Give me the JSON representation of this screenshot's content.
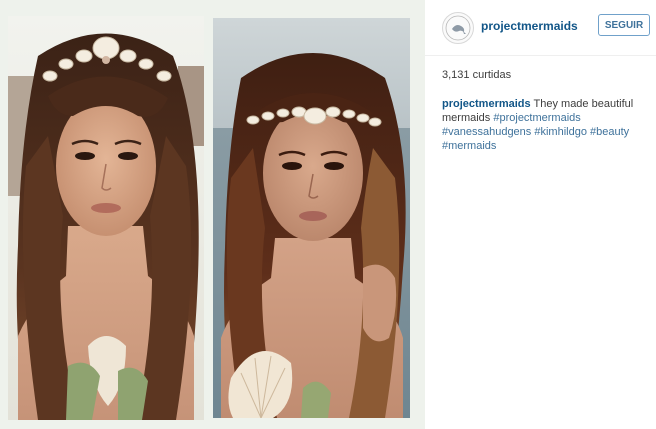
{
  "post": {
    "username": "projectmermaids",
    "follow_label": "SEGUIR",
    "likes": "3,131 curtidas",
    "caption": {
      "username": "projectmermaids",
      "text": "They made beautiful mermaids",
      "hashtags": [
        "#projectmermaids",
        "#vanessahudgens",
        "#kimhildgo",
        "#beauty",
        "#mermaids"
      ]
    }
  },
  "colors": {
    "link_blue": "#125688",
    "hashtag_blue": "#3f729b",
    "button_border": "#70a1ca",
    "photo_background": "#eef2ec"
  },
  "icons": {
    "avatar": "mermaid-logo-icon"
  }
}
